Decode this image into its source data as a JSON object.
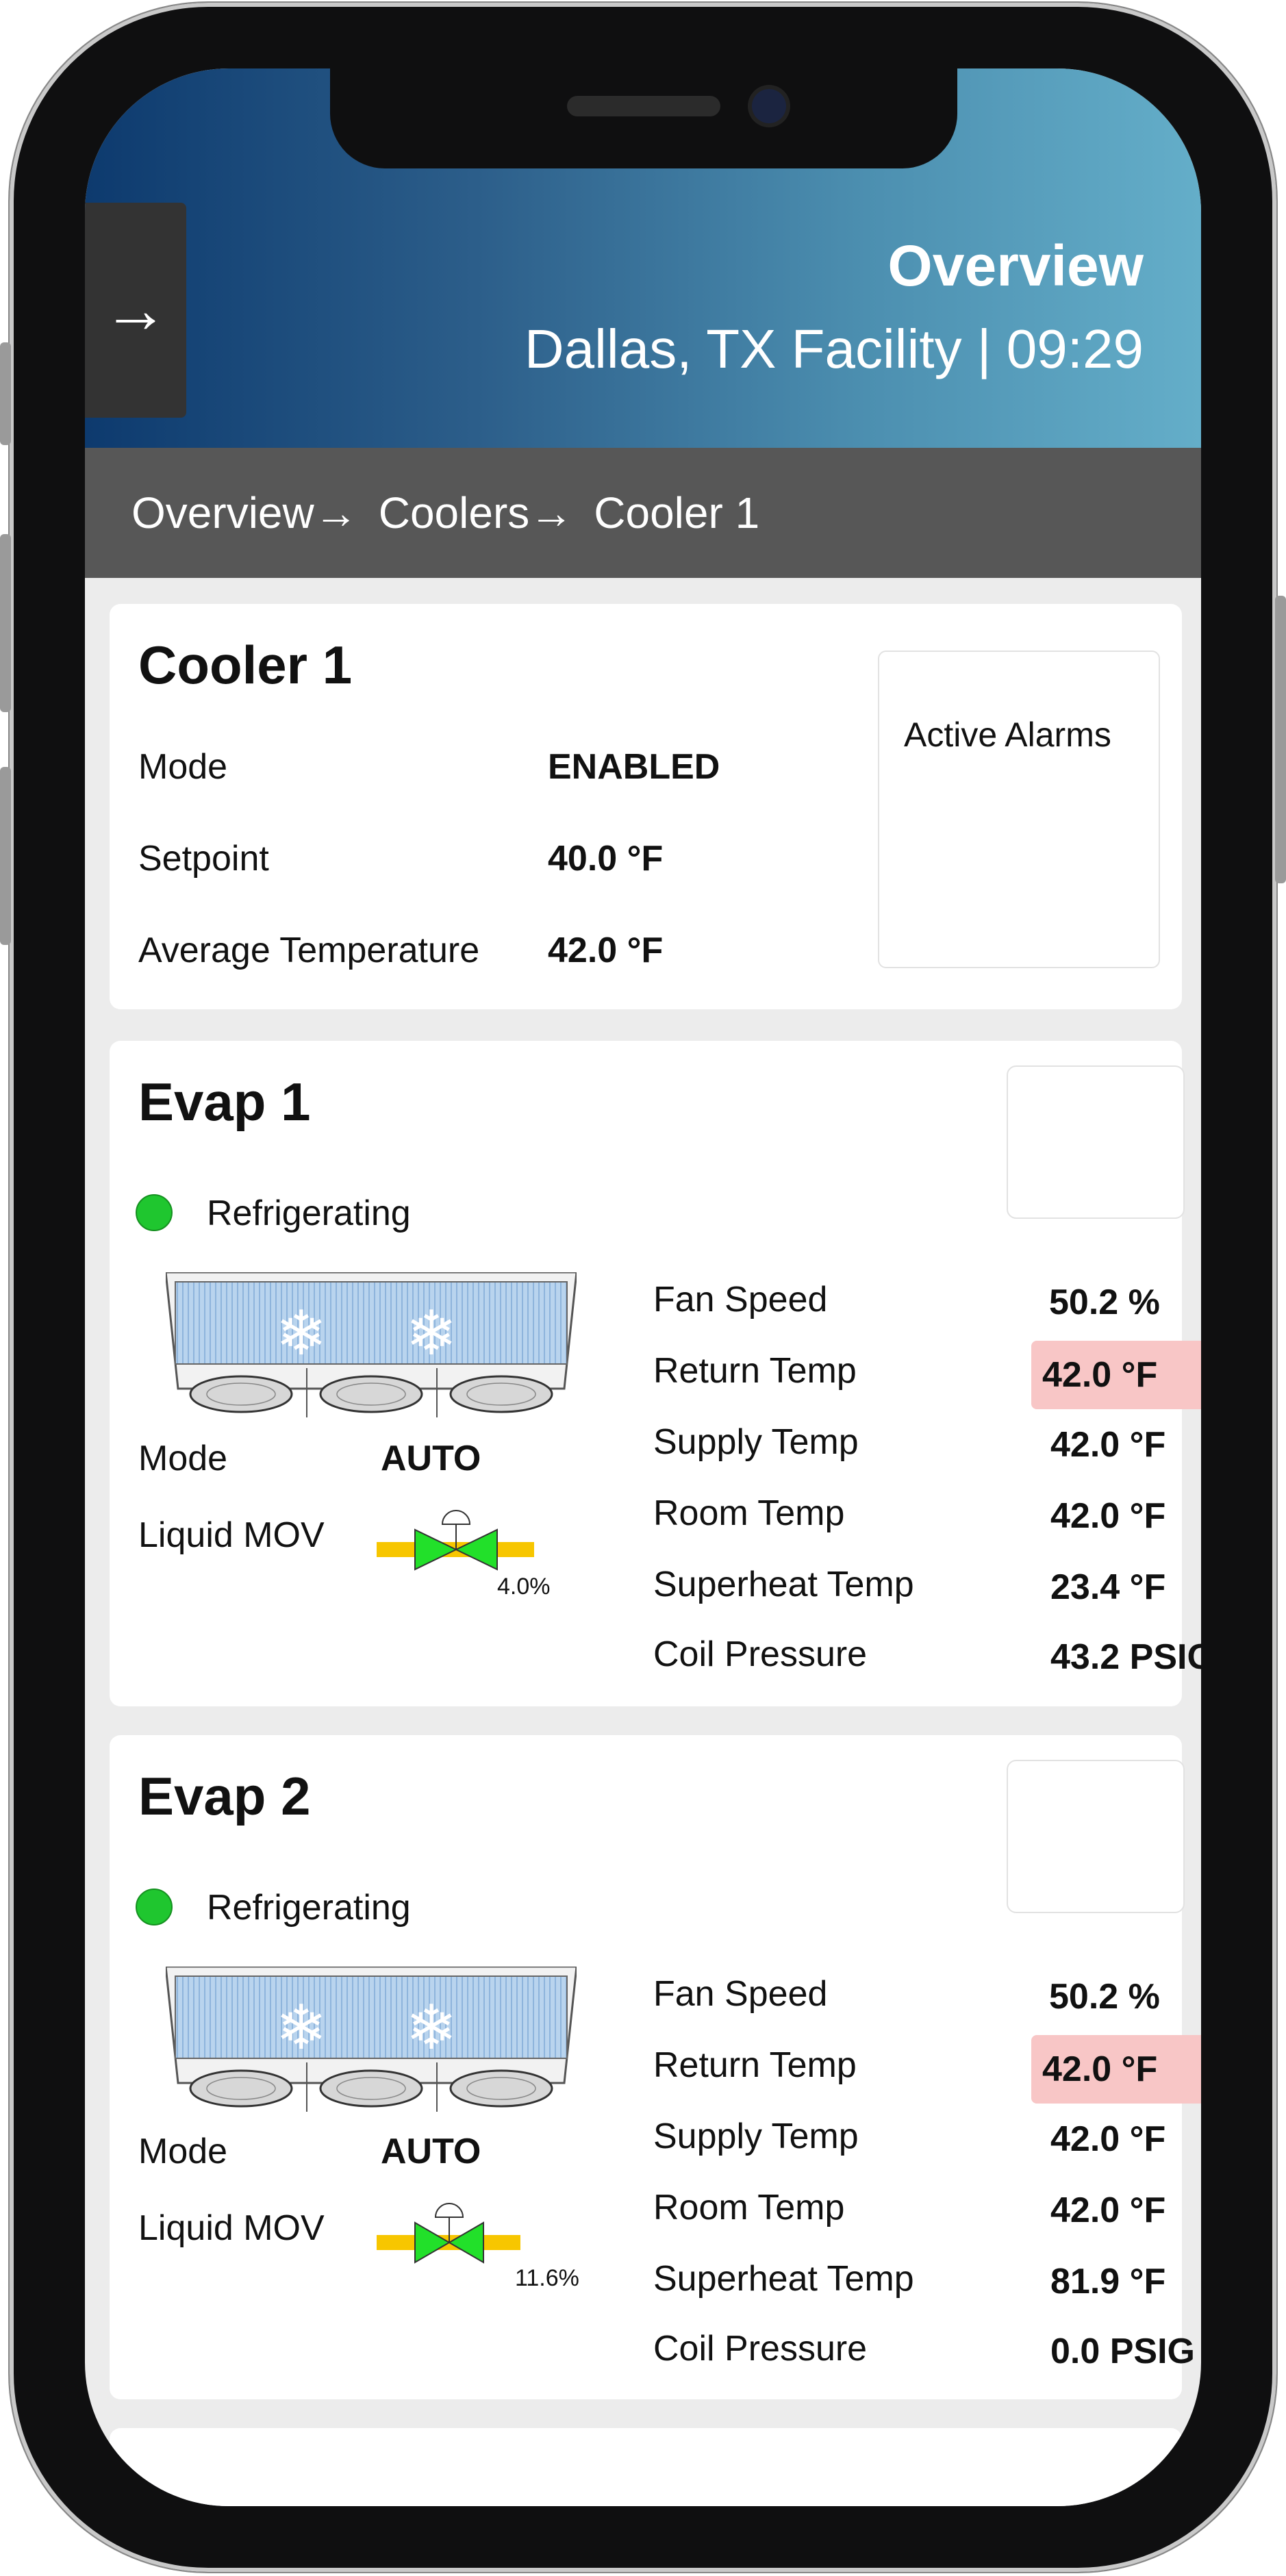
{
  "header": {
    "nav_arrow": "→",
    "title": "Overview",
    "subtitle": "Dallas, TX Facility |  09:29"
  },
  "breadcrumb": [
    "Overview→",
    "Coolers→",
    "Cooler 1"
  ],
  "cooler": {
    "title": "Cooler 1",
    "mode_label": "Mode",
    "mode_value": "ENABLED",
    "setpoint_label": "Setpoint",
    "setpoint_value": "40.0 °F",
    "avg_temp_label": "Average Temperature",
    "avg_temp_value": "42.0 °F",
    "alarms_label": "Active Alarms"
  },
  "evaps": [
    {
      "title": "Evap 1",
      "status": "Refrigerating",
      "mode_label": "Mode",
      "mode_value": "AUTO",
      "mov_label": "Liquid MOV",
      "mov_pct": "4.0%",
      "readings": [
        {
          "label": "Fan Speed",
          "value": "50.2 %"
        },
        {
          "label": "Return Temp",
          "value": "42.0 °F"
        },
        {
          "label": "Supply Temp",
          "value": "42.0 °F"
        },
        {
          "label": "Room Temp",
          "value": "42.0 °F"
        },
        {
          "label": "Superheat Temp",
          "value": "23.4 °F"
        },
        {
          "label": "Coil Pressure",
          "value": "43.2 PSIG"
        }
      ]
    },
    {
      "title": "Evap 2",
      "status": "Refrigerating",
      "mode_label": "Mode",
      "mode_value": "AUTO",
      "mov_label": "Liquid MOV",
      "mov_pct": "11.6%",
      "readings": [
        {
          "label": "Fan Speed",
          "value": "50.2 %"
        },
        {
          "label": "Return Temp",
          "value": "42.0 °F"
        },
        {
          "label": "Supply Temp",
          "value": "42.0 °F"
        },
        {
          "label": "Room Temp",
          "value": "42.0 °F"
        },
        {
          "label": "Superheat Temp",
          "value": "81.9 °F"
        },
        {
          "label": "Coil Pressure",
          "value": "0.0 PSIG"
        }
      ]
    }
  ],
  "colors": {
    "header_gradient_start": "#0d3a6e",
    "header_gradient_end": "#64aec9",
    "breadcrumb_bg": "#575757",
    "status_ok": "#1fc62f",
    "alert_bg": "#f8c6c6",
    "valve_green": "#22e02a",
    "valve_pipe": "#f7c600"
  }
}
